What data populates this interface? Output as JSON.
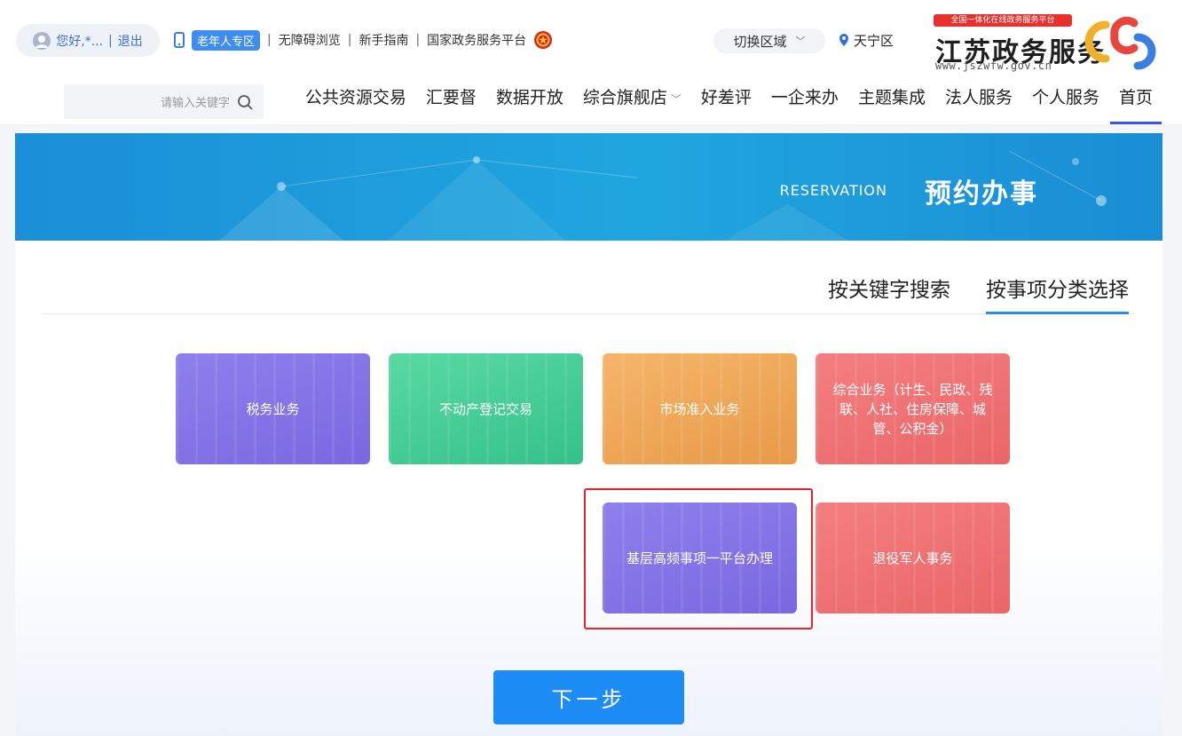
{
  "logo": {
    "badge": "全国一体化在线政务服务平台",
    "name": "江苏政务服务",
    "url": "www.jszwfw.gov.cn"
  },
  "location": {
    "label": "天宁区"
  },
  "region_switch": {
    "label": "切换区域"
  },
  "top_links": {
    "national_platform": "国家政务服务平台",
    "guide": "新手指南",
    "accessible": "无障碍浏览",
    "elder_zone": "老年人专区"
  },
  "user": {
    "greeting": "您好,*...",
    "logout": "退出"
  },
  "nav": [
    {
      "label": "首页",
      "active": true
    },
    {
      "label": "个人服务"
    },
    {
      "label": "法人服务"
    },
    {
      "label": "主题集成"
    },
    {
      "label": "一企来办"
    },
    {
      "label": "好差评"
    },
    {
      "label": "综合旗舰店",
      "dropdown": true
    },
    {
      "label": "数据开放"
    },
    {
      "label": "汇要督"
    },
    {
      "label": "公共资源交易"
    }
  ],
  "search": {
    "placeholder": "请输入关键字"
  },
  "banner": {
    "title": "预约办事",
    "subtitle": "RESERVATION"
  },
  "tabs": [
    {
      "label": "按事项分类选择",
      "active": true
    },
    {
      "label": "按关键字搜索"
    }
  ],
  "cards": [
    {
      "label": "综合业务（计生、民政、残联、人社、住房保障、城管、公积金）",
      "color": "#ef7273"
    },
    {
      "label": "市场准入业务",
      "color": "#eea85b"
    },
    {
      "label": "不动产登记交易",
      "color": "#45cd95"
    },
    {
      "label": "税务业务",
      "color": "#8474e6"
    },
    {
      "label": "退役军人事务",
      "color": "#ef7273"
    },
    {
      "label": "基层高频事项一平台办理",
      "color": "#8474e6"
    }
  ],
  "next_button": {
    "label": "下一步"
  },
  "colors": {
    "primary": "#1e8cf5",
    "nav_active": "#3455e6",
    "highlight": "#e8242a"
  }
}
